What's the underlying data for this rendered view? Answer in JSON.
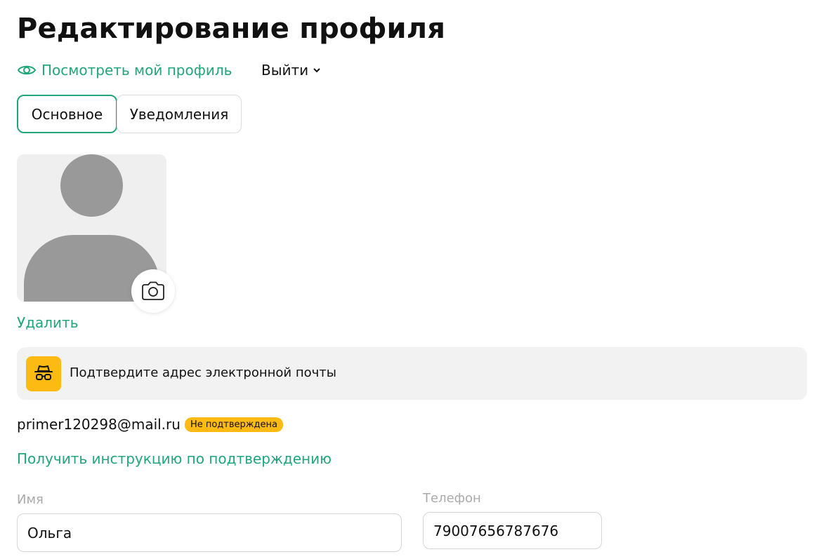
{
  "page": {
    "title": "Редактирование профиля"
  },
  "actions": {
    "view_profile": "Посмотреть мой профиль",
    "logout": "Выйти"
  },
  "tabs": [
    {
      "label": "Основное",
      "active": true
    },
    {
      "label": "Уведомления",
      "active": false
    }
  ],
  "avatar": {
    "icon": "user-placeholder-icon",
    "upload_icon": "camera-icon",
    "delete_label": "Удалить"
  },
  "email_notice": {
    "icon": "incognito-spy-icon",
    "text": "Подтвердите адрес электронной почты"
  },
  "email": {
    "address": "primer120298@mail.ru",
    "status": "Не подтверждена",
    "instruction_link": "Получить инструкцию по подтверждению"
  },
  "form": {
    "name": {
      "label": "Имя",
      "value": "Ольга"
    },
    "phone": {
      "label": "Телефон",
      "value": "79007656787676"
    }
  },
  "colors": {
    "accent": "#21a67a",
    "warning": "#fdba12",
    "placeholder_gray": "#999999"
  }
}
